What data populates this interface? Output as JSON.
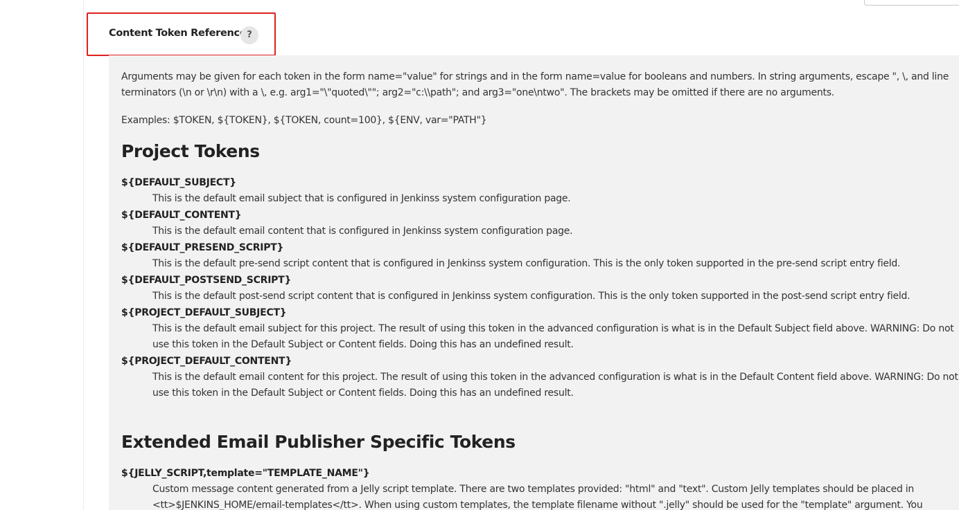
{
  "header": {
    "title": "Content Token Reference",
    "help_icon_glyph": "?"
  },
  "intro": {
    "arguments_text": "Arguments may be given for each token in the form name=\"value\" for strings and in the form name=value for booleans and numbers. In string arguments, escape \", \\, and line terminators (\\n or \\r\\n) with a \\, e.g. arg1=\"\\\"quoted\\\"\"; arg2=\"c:\\\\path\"; and arg3=\"one\\ntwo\". The brackets may be omitted if there are no arguments.",
    "examples_text": "Examples: $TOKEN, ${TOKEN}, ${TOKEN, count=100}, ${ENV, var=\"PATH\"}"
  },
  "project_tokens": {
    "heading": "Project Tokens",
    "items": [
      {
        "name": "${DEFAULT_SUBJECT}",
        "description": "This is the default email subject that is configured in Jenkinss system configuration page."
      },
      {
        "name": "${DEFAULT_CONTENT}",
        "description": "This is the default email content that is configured in Jenkinss system configuration page."
      },
      {
        "name": "${DEFAULT_PRESEND_SCRIPT}",
        "description": "This is the default pre-send script content that is configured in Jenkinss system configuration. This is the only token supported in the pre-send script entry field."
      },
      {
        "name": "${DEFAULT_POSTSEND_SCRIPT}",
        "description": "This is the default post-send script content that is configured in Jenkinss system configuration. This is the only token supported in the post-send script entry field."
      },
      {
        "name": "${PROJECT_DEFAULT_SUBJECT}",
        "description": "This is the default email subject for this project. The result of using this token in the advanced configuration is what is in the Default Subject field above. WARNING: Do not use this token in the Default Subject or Content fields. Doing this has an undefined result."
      },
      {
        "name": "${PROJECT_DEFAULT_CONTENT}",
        "description": "This is the default email content for this project. The result of using this token in the advanced configuration is what is in the Default Content field above. WARNING: Do not use this token in the Default Subject or Content fields. Doing this has an undefined result."
      }
    ]
  },
  "extended_tokens": {
    "heading": "Extended Email Publisher Specific Tokens",
    "items": [
      {
        "name": "${JELLY_SCRIPT,template=\"TEMPLATE_NAME\"}",
        "description": "Custom message content generated from a Jelly script template. There are two templates provided: \"html\" and \"text\". Custom Jelly templates should be placed in <tt>$JENKINS_HOME/email-templates</tt>. When using custom templates, the template filename without \".jelly\" should be used for the \"template\" argument. You"
      }
    ]
  }
}
